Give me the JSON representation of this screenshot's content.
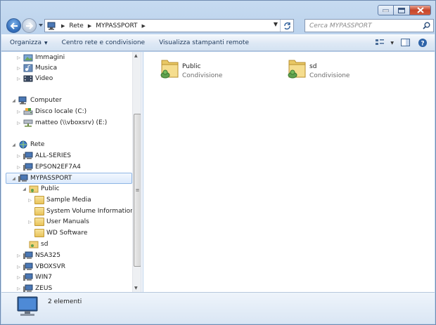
{
  "address": {
    "segments": [
      "Rete",
      "MYPASSPORT"
    ],
    "search_placeholder": "Cerca MYPASSPORT"
  },
  "toolbar": {
    "organize": "Organizza",
    "network_center": "Centro rete e condivisione",
    "printers": "Visualizza stampanti remote"
  },
  "tree": {
    "items": [
      {
        "label": "Immagini",
        "icon": "pictures-library-icon"
      },
      {
        "label": "Musica",
        "icon": "music-library-icon"
      },
      {
        "label": "Video",
        "icon": "video-library-icon"
      },
      {
        "label": "Computer",
        "icon": "computer-icon"
      },
      {
        "label": "Disco locale (C:)",
        "icon": "local-disk-icon"
      },
      {
        "label": "matteo (\\\\vboxsrv) (E:)",
        "icon": "network-drive-icon"
      },
      {
        "label": "Rete",
        "icon": "network-icon"
      },
      {
        "label": "ALL-SERIES",
        "icon": "network-computer-icon"
      },
      {
        "label": "EPSON2EF7A4",
        "icon": "network-computer-icon"
      },
      {
        "label": "MYPASSPORT",
        "icon": "network-computer-icon"
      },
      {
        "label": "Public",
        "icon": "shared-folder-icon"
      },
      {
        "label": "Sample Media",
        "icon": "folder-icon"
      },
      {
        "label": "System Volume Information",
        "icon": "folder-icon"
      },
      {
        "label": "User Manuals",
        "icon": "folder-icon"
      },
      {
        "label": "WD Software",
        "icon": "folder-icon"
      },
      {
        "label": "sd",
        "icon": "shared-folder-icon"
      },
      {
        "label": "NSA325",
        "icon": "network-computer-icon"
      },
      {
        "label": "VBOXSVR",
        "icon": "network-computer-icon"
      },
      {
        "label": "WIN7",
        "icon": "network-computer-icon"
      },
      {
        "label": "ZEUS",
        "icon": "network-computer-icon"
      }
    ]
  },
  "content": {
    "items": [
      {
        "name": "Public",
        "type": "Condivisione"
      },
      {
        "name": "sd",
        "type": "Condivisione"
      }
    ]
  },
  "status": {
    "count": "2 elementi"
  },
  "colors": {
    "selection_border": "#8fb6e5",
    "window_frame": "#b9d1ec",
    "close_button": "#c6452a"
  }
}
